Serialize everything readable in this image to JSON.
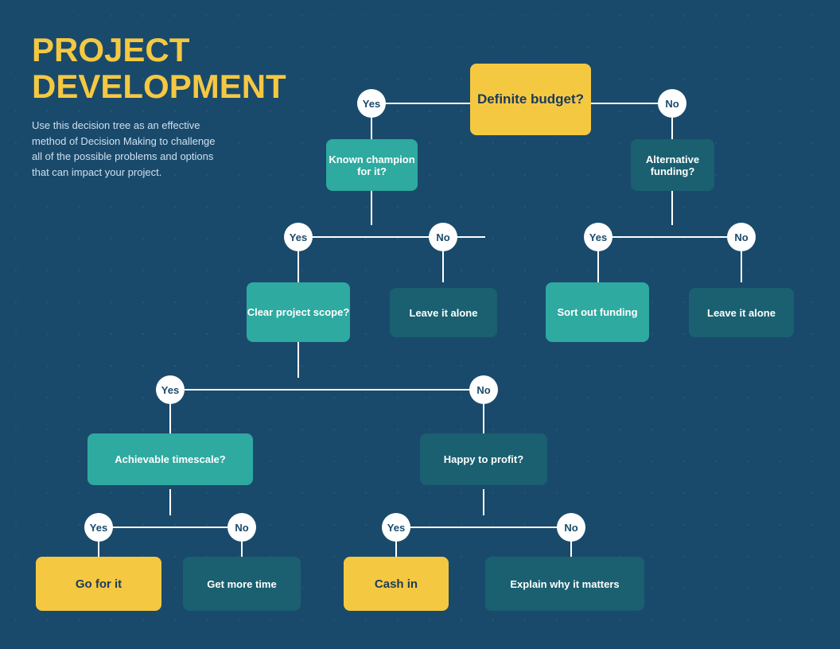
{
  "title": {
    "heading_line1": "PROJECT",
    "heading_line2": "DEVELOPMENT",
    "description": "Use this decision tree as an effective method of Decision Making to challenge all of the possible problems and options that can impact your project."
  },
  "nodes": {
    "definite_budget": "Definite budget?",
    "known_champion": "Known champion for it?",
    "alternative_funding": "Alternative funding?",
    "clear_project_scope": "Clear project scope?",
    "leave_it_alone_1": "Leave it alone",
    "sort_out_funding": "Sort out funding",
    "leave_it_alone_2": "Leave it alone",
    "achievable_timescale": "Achievable timescale?",
    "happy_to_profit": "Happy to profit?",
    "go_for_it": "Go for it",
    "get_more_time": "Get more time",
    "cash_in": "Cash in",
    "explain_why": "Explain why it matters"
  },
  "labels": {
    "yes": "Yes",
    "no": "No"
  },
  "colors": {
    "background": "#1a4a6b",
    "yellow": "#f5c842",
    "teal": "#2eaaa0",
    "dark_teal": "#1a6070",
    "white": "#ffffff",
    "title_color": "#f5c842",
    "text_light": "#cde0f0"
  }
}
